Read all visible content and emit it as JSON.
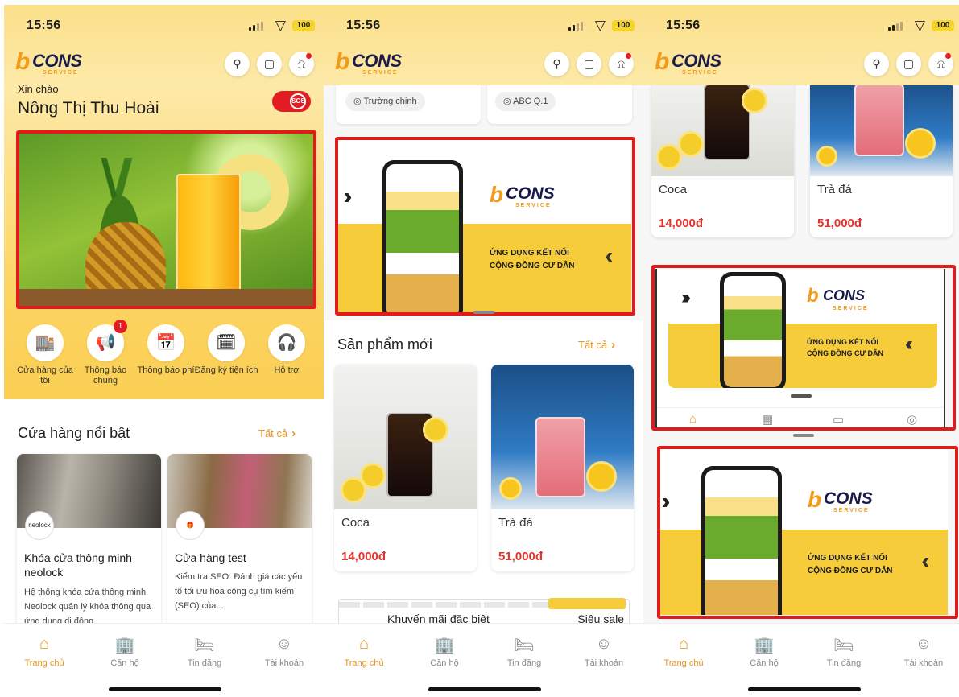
{
  "status": {
    "time": "15:56",
    "battery": "100"
  },
  "logo": {
    "word": "CONS",
    "sub": "SERVICE"
  },
  "header": {
    "search_icon": "search-icon",
    "cart_icon": "shopping-bag-icon",
    "bell_icon": "bell-icon"
  },
  "greeting": {
    "hello": "Xin chào",
    "name": "Nông Thị Thu Hoài",
    "sos": "SOS"
  },
  "quick_actions": [
    {
      "label": "Cửa hàng của tôi",
      "icon": "store-icon"
    },
    {
      "label": "Thông báo chung",
      "icon": "megaphone-icon",
      "badge": "1"
    },
    {
      "label": "Thông báo phí",
      "icon": "invoice-icon"
    },
    {
      "label": "Đăng ký tiện ích",
      "icon": "calendar-icon"
    },
    {
      "label": "Hỗ trợ",
      "icon": "headset-icon"
    }
  ],
  "featured_stores": {
    "title": "Cửa hàng nổi bật",
    "see_all": "Tất cả",
    "items": [
      {
        "avatar": "neolock",
        "name": "Khóa cửa thông minh neolock",
        "desc": "Hệ thống khóa cửa thông minh Neolock quản lý khóa thông qua ứng dụng di động."
      },
      {
        "avatar": "",
        "name": "Cửa hàng test",
        "desc": "Kiểm tra SEO: Đánh giá các yếu tố tối ưu hóa công cụ tìm kiếm (SEO) của..."
      }
    ]
  },
  "locations": [
    "Trường chinh",
    "ABC Q.1"
  ],
  "banner": {
    "tagline_1": "ỨNG DỤNG KẾT NỐI",
    "tagline_2": "CỘNG ĐỒNG CƯ DÂN"
  },
  "new_products": {
    "title": "Sản phẩm mới",
    "see_all": "Tất cả",
    "items": [
      {
        "name": "Coca",
        "price": "14,000đ"
      },
      {
        "name": "Trà đá",
        "price": "51,000đ"
      }
    ]
  },
  "promo": {
    "left": "Khuyến mãi đặc biệt",
    "right": "Siêu sale"
  },
  "bottom_nav": [
    {
      "label": "Trang chủ",
      "icon": "home-icon",
      "active": true
    },
    {
      "label": "Căn hộ",
      "icon": "building-icon"
    },
    {
      "label": "Tin đăng",
      "icon": "bed-icon"
    },
    {
      "label": "Tài khoản",
      "icon": "account-icon"
    }
  ],
  "colors": {
    "accent": "#e8951a",
    "highlight": "#e11b1b",
    "price": "#e4332c",
    "banner": "#f6cc3a"
  }
}
